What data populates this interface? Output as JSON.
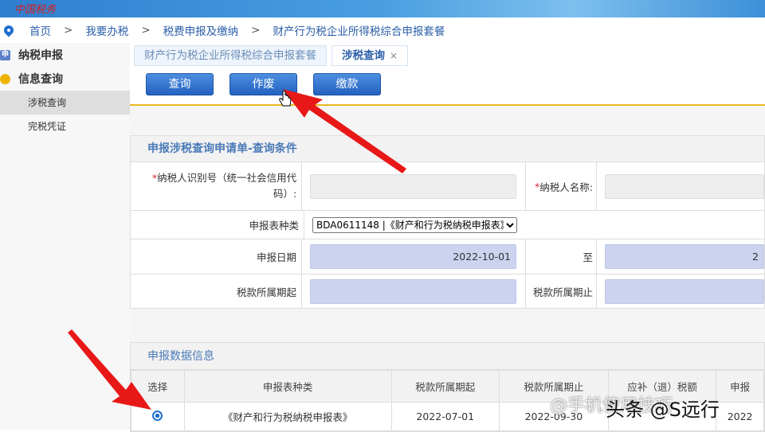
{
  "header": {
    "logo": "中国税务"
  },
  "breadcrumb": [
    "首页",
    "我要办税",
    "税费申报及缴纳",
    "财产行为税企业所得税综合申报套餐"
  ],
  "sidebar": {
    "groups": [
      {
        "label": "纳税申报",
        "icon": "申"
      },
      {
        "label": "信息查询",
        "items": [
          "涉税查询",
          "完税凭证"
        ]
      }
    ]
  },
  "tabs": [
    {
      "label": "财产行为税企业所得税综合申报套餐"
    },
    {
      "label": "涉税查询",
      "close": "×"
    }
  ],
  "toolbar": {
    "query": "查询",
    "void": "作废",
    "pay": "缴款"
  },
  "form": {
    "title": "申报涉税查询申请单-查询条件",
    "taxpayer_id_label": "纳税人识别号（统一社会信用代码）:",
    "taxpayer_name_label": "纳税人名称:",
    "form_type_label": "申报表种类",
    "form_type_value": "BDA0611148 |《财产和行为税纳税申报表》",
    "date_label": "申报日期",
    "date_from": "2022-10-01",
    "to_label": "至",
    "date_to": "2",
    "period_start_label": "税款所属期起",
    "period_end_label": "税款所属期止"
  },
  "results": {
    "title": "申报数据信息",
    "headers": [
      "选择",
      "申报表种类",
      "税款所属期起",
      "税款所属期止",
      "应补（退）税额",
      "申报"
    ],
    "rows": [
      {
        "type": "《财产和行为税纳税申报表》",
        "start": "2022-07-01",
        "end": "2022-09-30",
        "amount": "",
        "date": "2022"
      }
    ]
  },
  "watermark": {
    "a": "@手机使用技巧",
    "b": "头条 @S远行"
  },
  "colors": {
    "accent": "#2a5ea8",
    "button": "#2f6fd0",
    "divider": "#e8b820"
  }
}
